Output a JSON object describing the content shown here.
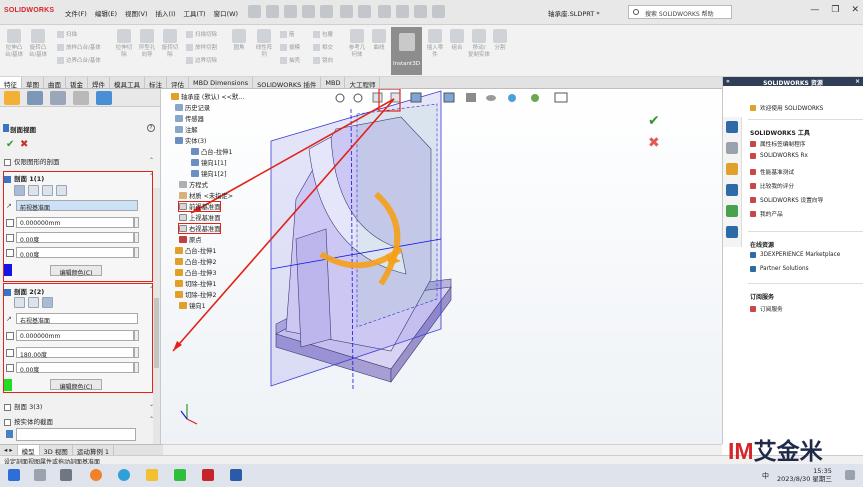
{
  "app": {
    "logo": "SOLIDWORKS",
    "doc_title": "轴承座.SLDPRT *"
  },
  "menus": [
    "文件(F)",
    "编辑(E)",
    "视图(V)",
    "插入(I)",
    "工具(T)",
    "窗口(W)"
  ],
  "search": {
    "placeholder": "搜索 SOLIDWORKS 帮助"
  },
  "window_controls": [
    "—",
    "❐",
    "✕"
  ],
  "toolbar": {
    "big_buttons": [
      "拉伸凸\n台/基体",
      "旋转凸\n台/基体",
      "拉伸切\n除",
      "异型孔\n向导",
      "旋转切\n除",
      "圆角",
      "线性阵\n列",
      "筋",
      "拔模",
      "参考几\n何体",
      "曲线",
      "插入零\n件",
      "组合",
      "移动/\n复制实体",
      "分割"
    ],
    "small_buttons": [
      "扫描",
      "放样凸台/基体",
      "边界凸台/基体",
      "扫描切除",
      "放样切割",
      "边界切除",
      "包覆",
      "相交",
      "抽壳",
      "镜向"
    ],
    "instant3d": "Instant3D"
  },
  "tabs": [
    "特征",
    "草图",
    "曲面",
    "钣金",
    "焊件",
    "模具工具",
    "标注",
    "评估",
    "MBD Dimensions",
    "SOLIDWORKS 插件",
    "MBD",
    "大工程师"
  ],
  "property_manager": {
    "title": "剖面视图",
    "help": "?",
    "option_section_plane": "仅限图形的剖面",
    "section1": {
      "title": "剖面 1(1)",
      "plane": "前视基准面",
      "offset": "0.000000mm",
      "angle1": "0.00度",
      "angle2": "0.00度",
      "color_button": "编辑颜色(C)",
      "color": "#1414e6"
    },
    "section2": {
      "title": "剖面 2(2)",
      "plane": "右视基准面",
      "offset": "0.000000mm",
      "angle1": "180.00度",
      "angle2": "0.00度",
      "color_button": "编辑颜色(C)",
      "color": "#22dd22"
    },
    "section3": "剖面 3(3)",
    "by_body": "按实体的截面"
  },
  "tree": {
    "root": "轴承座 (默认) <<默...",
    "items": [
      "历史记录",
      "传感器",
      "注解",
      "实体(3)",
      "凸台-拉伸1",
      "镜向1[1]",
      "镜向1[2]",
      "方程式",
      "材质 <未指定>",
      "前视基准面",
      "上视基准面",
      "右视基准面",
      "原点",
      "凸台-拉伸1",
      "凸台-拉伸2",
      "凸台-拉伸3",
      "切除-拉伸1",
      "切除-拉伸2",
      "镜向1"
    ]
  },
  "right_panel": {
    "title": "SOLIDWORKS 资源",
    "welcome": "欢迎使用 SOLIDWORKS",
    "tools_title": "SOLIDWORKS 工具",
    "tools": [
      "属性标签编制程序",
      "SOLIDWORKS Rx",
      "性能基准测试",
      "比较我的评分",
      "SOLIDWORKS 设置向导",
      "我的产品"
    ],
    "online_title": "在线资源",
    "online": [
      "3DEXPERIENCE Marketplace",
      "Partner Solutions"
    ],
    "sub_title": "订阅服务",
    "sub": [
      "订阅服务"
    ]
  },
  "model_tabs": [
    "模型",
    "3D 视图",
    "运动算例 1"
  ],
  "status_text": "设定剖面视图属性或拖动剖面基准面",
  "taskbar": {
    "time": "15:35",
    "date": "2023/8/30 星期三",
    "ime": "中"
  },
  "watermark": {
    "im": "IM",
    "text": "艾金米"
  },
  "colors": {
    "accent_red": "#e0241a",
    "model_purple": "#c9c2ec",
    "arrow_orange": "#f5a01a"
  }
}
